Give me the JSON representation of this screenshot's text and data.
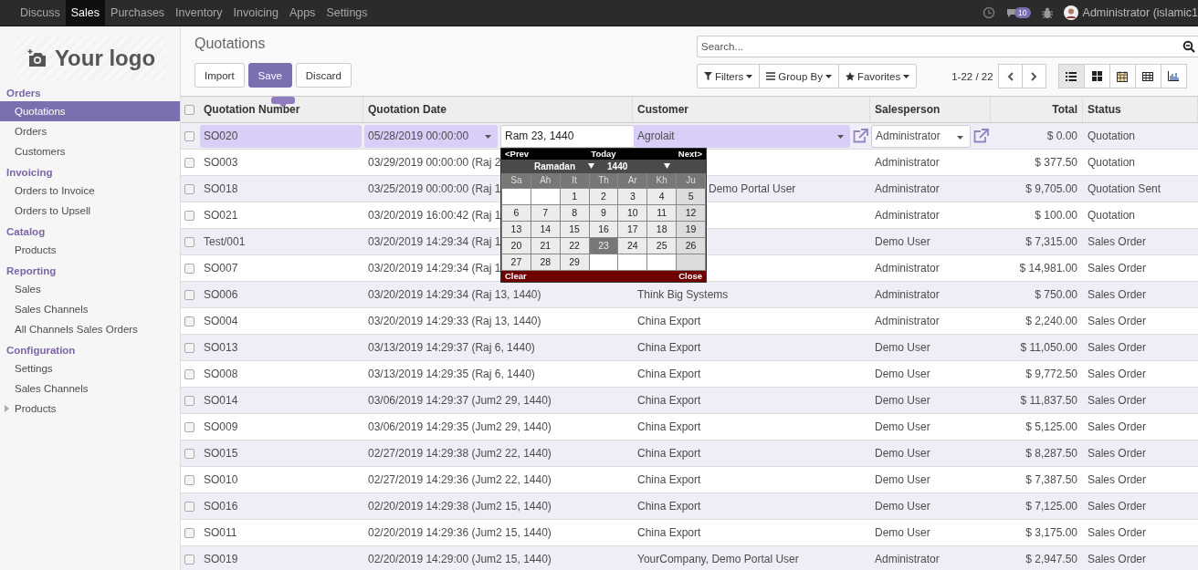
{
  "topbar": {
    "apps": [
      {
        "label": "Discuss",
        "selected": false
      },
      {
        "label": "Sales",
        "selected": true
      },
      {
        "label": "Purchases",
        "selected": false
      },
      {
        "label": "Inventory",
        "selected": false
      },
      {
        "label": "Invoicing",
        "selected": false
      },
      {
        "label": "Apps",
        "selected": false
      },
      {
        "label": "Settings",
        "selected": false
      }
    ],
    "badge": "10",
    "user": "Administrator (islamic1"
  },
  "logo": "Your logo",
  "sidebar": {
    "sections": [
      {
        "title": "Orders",
        "items": [
          {
            "label": "Quotations",
            "selected": true,
            "kind": "link"
          },
          {
            "label": "Orders",
            "selected": false,
            "kind": "link"
          },
          {
            "label": "Customers",
            "selected": false,
            "kind": "link"
          }
        ]
      },
      {
        "title": "Invoicing",
        "items": [
          {
            "label": "Orders to Invoice",
            "selected": false,
            "kind": "link"
          },
          {
            "label": "Orders to Upsell",
            "selected": false,
            "kind": "link"
          }
        ]
      },
      {
        "title": "Catalog",
        "items": [
          {
            "label": "Products",
            "selected": false,
            "kind": "link"
          }
        ]
      },
      {
        "title": "Reporting",
        "items": [
          {
            "label": "Sales",
            "selected": false,
            "kind": "link"
          },
          {
            "label": "Sales Channels",
            "selected": false,
            "kind": "link"
          },
          {
            "label": "All Channels Sales Orders",
            "selected": false,
            "kind": "link"
          }
        ]
      },
      {
        "title": "Configuration",
        "items": [
          {
            "label": "Settings",
            "selected": false,
            "kind": "link"
          },
          {
            "label": "Sales Channels",
            "selected": false,
            "kind": "link"
          },
          {
            "label": "Products",
            "selected": false,
            "kind": "folder"
          }
        ]
      }
    ]
  },
  "page_title": "Quotations",
  "buttons": [
    {
      "label": "Import",
      "kind": "default"
    },
    {
      "label": "Save",
      "kind": "primary"
    },
    {
      "label": "Discard",
      "kind": "default"
    }
  ],
  "search": {
    "placeholder": "Search..."
  },
  "filters": [
    {
      "label": "Filters",
      "kind": "filter"
    },
    {
      "label": "Group By",
      "kind": "group"
    },
    {
      "label": "Favorites",
      "kind": "star"
    }
  ],
  "pager": "1-22 / 22",
  "views": [
    {
      "kind": "list",
      "selected": true
    },
    {
      "kind": "kanban",
      "selected": false
    },
    {
      "kind": "calendar",
      "selected": false
    },
    {
      "kind": "pivot",
      "selected": false
    },
    {
      "kind": "graph",
      "selected": false
    }
  ],
  "table": {
    "all_checked": false,
    "columns": [
      "Quotation Number",
      "Quotation Date",
      "Customer",
      "Salesperson",
      "Total",
      "Status"
    ],
    "edit_row": {
      "checked": false,
      "number": "SO020",
      "date": "05/28/2019 00:00:00",
      "hijri_input": "Ram 23, 1440",
      "customer": "Agrolait",
      "salesperson": "Administrator",
      "total": "$ 0.00",
      "status": "Quotation"
    },
    "rows": [
      {
        "checked": false,
        "number": "SO003",
        "date": "03/29/2019 00:00:00 (Raj 2",
        "customer": "",
        "salesperson": "Administrator",
        "total": "$ 377.50",
        "status": "Quotation"
      },
      {
        "checked": false,
        "number": "SO018",
        "date": "03/25/2019 00:00:00 (Raj 1",
        "customer": "Demo Portal User",
        "salesperson": "Administrator",
        "total": "$ 9,705.00",
        "status": "Quotation Sent"
      },
      {
        "checked": false,
        "number": "SO021",
        "date": "03/20/2019 16:00:42 (Raj 1",
        "customer": "",
        "salesperson": "Administrator",
        "total": "$ 100.00",
        "status": "Quotation"
      },
      {
        "checked": false,
        "number": "Test/001",
        "date": "03/20/2019 14:29:34 (Raj 1",
        "customer": "",
        "salesperson": "Demo User",
        "total": "$ 7,315.00",
        "status": "Sales Order"
      },
      {
        "checked": false,
        "number": "SO007",
        "date": "03/20/2019 14:29:34 (Raj 1",
        "customer": "",
        "salesperson": "Administrator",
        "total": "$ 14,981.00",
        "status": "Sales Order"
      },
      {
        "checked": false,
        "number": "SO006",
        "date": "03/20/2019 14:29:34 (Raj 13, 1440)",
        "customer": "Think Big Systems",
        "salesperson": "Administrator",
        "total": "$ 750.00",
        "status": "Sales Order"
      },
      {
        "checked": false,
        "number": "SO004",
        "date": "03/20/2019 14:29:33 (Raj 13, 1440)",
        "customer": "China Export",
        "salesperson": "Administrator",
        "total": "$ 2,240.00",
        "status": "Sales Order"
      },
      {
        "checked": false,
        "number": "SO013",
        "date": "03/13/2019 14:29:37 (Raj 6, 1440)",
        "customer": "China Export",
        "salesperson": "Demo User",
        "total": "$ 11,050.00",
        "status": "Sales Order"
      },
      {
        "checked": false,
        "number": "SO008",
        "date": "03/13/2019 14:29:35 (Raj 6, 1440)",
        "customer": "China Export",
        "salesperson": "Demo User",
        "total": "$ 9,772.50",
        "status": "Sales Order"
      },
      {
        "checked": false,
        "number": "SO014",
        "date": "03/06/2019 14:29:37 (Jum2 29, 1440)",
        "customer": "China Export",
        "salesperson": "Demo User",
        "total": "$ 11,837.50",
        "status": "Sales Order"
      },
      {
        "checked": false,
        "number": "SO009",
        "date": "03/06/2019 14:29:35 (Jum2 29, 1440)",
        "customer": "China Export",
        "salesperson": "Demo User",
        "total": "$ 5,125.00",
        "status": "Sales Order"
      },
      {
        "checked": false,
        "number": "SO015",
        "date": "02/27/2019 14:29:38 (Jum2 22, 1440)",
        "customer": "China Export",
        "salesperson": "Demo User",
        "total": "$ 8,287.50",
        "status": "Sales Order"
      },
      {
        "checked": false,
        "number": "SO010",
        "date": "02/27/2019 14:29:36 (Jum2 22, 1440)",
        "customer": "China Export",
        "salesperson": "Demo User",
        "total": "$ 7,387.50",
        "status": "Sales Order"
      },
      {
        "checked": false,
        "number": "SO016",
        "date": "02/20/2019 14:29:38 (Jum2 15, 1440)",
        "customer": "China Export",
        "salesperson": "Demo User",
        "total": "$ 7,125.00",
        "status": "Sales Order"
      },
      {
        "checked": false,
        "number": "SO011",
        "date": "02/20/2019 14:29:36 (Jum2 15, 1440)",
        "customer": "China Export",
        "salesperson": "Demo User",
        "total": "$ 3,175.00",
        "status": "Sales Order"
      },
      {
        "checked": false,
        "number": "SO019",
        "date": "02/20/2019 14:29:00 (Jum2 15, 1440)",
        "customer": "YourCompany, Demo Portal User",
        "salesperson": "Administrator",
        "total": "$ 2,947.50",
        "status": "Sales Order"
      }
    ]
  },
  "datepicker": {
    "prev": "<Prev",
    "today": "Today",
    "next": "Next>",
    "month": "Ramadan",
    "year": "1440",
    "weekdays": [
      "Sa",
      "Ah",
      "It",
      "Th",
      "Ar",
      "Kh",
      "Ju"
    ],
    "weeks": [
      [
        {
          "kind": "blank"
        },
        {
          "kind": "blank"
        },
        {
          "kind": "day",
          "label": "1",
          "selected": false
        },
        {
          "kind": "day",
          "label": "2",
          "selected": false
        },
        {
          "kind": "day",
          "label": "3",
          "selected": false
        },
        {
          "kind": "day",
          "label": "4",
          "selected": false
        },
        {
          "kind": "day",
          "label": "5",
          "selected": false
        }
      ],
      [
        {
          "kind": "day",
          "label": "6",
          "selected": false
        },
        {
          "kind": "day",
          "label": "7",
          "selected": false
        },
        {
          "kind": "day",
          "label": "8",
          "selected": false
        },
        {
          "kind": "day",
          "label": "9",
          "selected": false
        },
        {
          "kind": "day",
          "label": "10",
          "selected": false
        },
        {
          "kind": "day",
          "label": "11",
          "selected": false
        },
        {
          "kind": "day",
          "label": "12",
          "selected": false
        }
      ],
      [
        {
          "kind": "day",
          "label": "13",
          "selected": false
        },
        {
          "kind": "day",
          "label": "14",
          "selected": false
        },
        {
          "kind": "day",
          "label": "15",
          "selected": false
        },
        {
          "kind": "day",
          "label": "16",
          "selected": false
        },
        {
          "kind": "day",
          "label": "17",
          "selected": false
        },
        {
          "kind": "day",
          "label": "18",
          "selected": false
        },
        {
          "kind": "day",
          "label": "19",
          "selected": false
        }
      ],
      [
        {
          "kind": "day",
          "label": "20",
          "selected": false
        },
        {
          "kind": "day",
          "label": "21",
          "selected": false
        },
        {
          "kind": "day",
          "label": "22",
          "selected": false
        },
        {
          "kind": "day",
          "label": "23",
          "selected": true
        },
        {
          "kind": "day",
          "label": "24",
          "selected": false
        },
        {
          "kind": "day",
          "label": "25",
          "selected": false
        },
        {
          "kind": "day",
          "label": "26",
          "selected": false
        }
      ],
      [
        {
          "kind": "day",
          "label": "27",
          "selected": false
        },
        {
          "kind": "day",
          "label": "28",
          "selected": false
        },
        {
          "kind": "day",
          "label": "29",
          "selected": false
        },
        {
          "kind": "blank"
        },
        {
          "kind": "blank"
        },
        {
          "kind": "blank"
        },
        {
          "kind": "blank"
        }
      ]
    ],
    "clear": "Clear",
    "close": "Close"
  }
}
